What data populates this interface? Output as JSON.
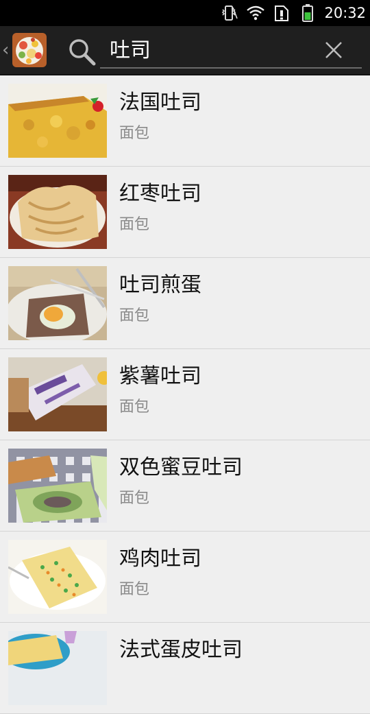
{
  "status_bar": {
    "time": "20:32",
    "icons": [
      "vibrate-icon",
      "wifi-icon",
      "sim-alert-icon",
      "battery-icon"
    ]
  },
  "action_bar": {
    "back_icon": "chevron-left-icon",
    "app_icon": "app-logo-icon",
    "search_icon": "search-icon",
    "search_query": "吐司",
    "clear_icon": "close-icon"
  },
  "results": [
    {
      "title": "法国吐司",
      "category": "面包",
      "thumb": "french-toast"
    },
    {
      "title": "红枣吐司",
      "category": "面包",
      "thumb": "red-date-toast"
    },
    {
      "title": "吐司煎蛋",
      "category": "面包",
      "thumb": "toast-egg"
    },
    {
      "title": "紫薯吐司",
      "category": "面包",
      "thumb": "purple-potato-toast"
    },
    {
      "title": "双色蜜豆吐司",
      "category": "面包",
      "thumb": "two-color-bean-toast"
    },
    {
      "title": "鸡肉吐司",
      "category": "面包",
      "thumb": "chicken-toast"
    },
    {
      "title": "法式蛋皮吐司",
      "category": "",
      "thumb": "egg-crepe-toast"
    }
  ]
}
